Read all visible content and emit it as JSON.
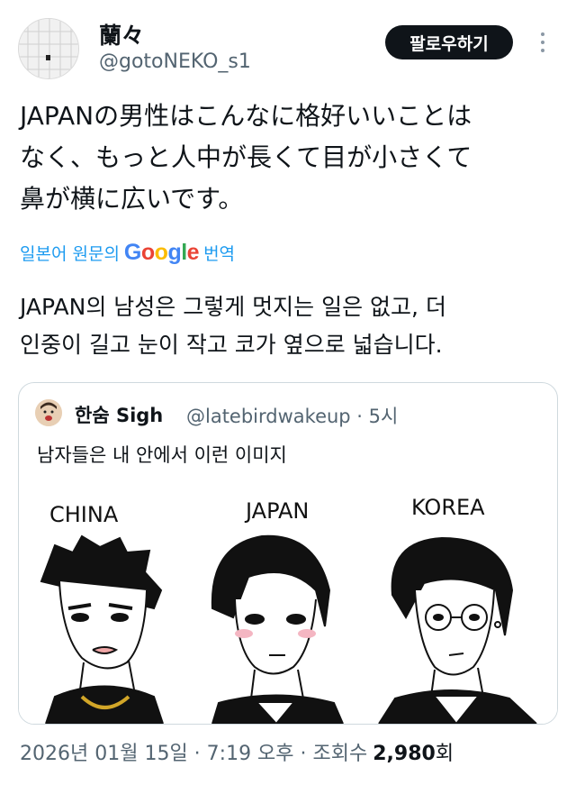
{
  "author": {
    "display_name": "蘭々",
    "handle": "@gotoNEKO_s1"
  },
  "follow_button_label": "팔로우하기",
  "tweet_text": "JAPANの男性はこんなに格好いいことは\nなく、もっと人中が長くて目が小さくて\n鼻が横に広いです。",
  "translation": {
    "prefix": "일본어 원문의",
    "suffix": "번역"
  },
  "translated_text": "JAPAN의 남성은 그렇게 멋지는 일은 없고, 더\n인중이 길고 눈이 작고 코가 옆으로 넓습니다.",
  "quote": {
    "display_name": "한숨 Sigh",
    "handle_and_time": "@latebirdwakeup · 5시",
    "text": "남자들은 내 안에서 이런 이미지",
    "panels": [
      "CHINA",
      "JAPAN",
      "KOREA"
    ]
  },
  "meta": {
    "date_time": "2026년 01월 15일 · 7:19 오후 · 조회수",
    "views_count": "2,980",
    "views_suffix": "회"
  },
  "colors": {
    "link": "#1d9bf0",
    "secondary_text": "#536471",
    "primary_text": "#0f1419",
    "button_bg": "#0f1419"
  },
  "icons": [
    "more-dots-icon",
    "google-logo"
  ]
}
